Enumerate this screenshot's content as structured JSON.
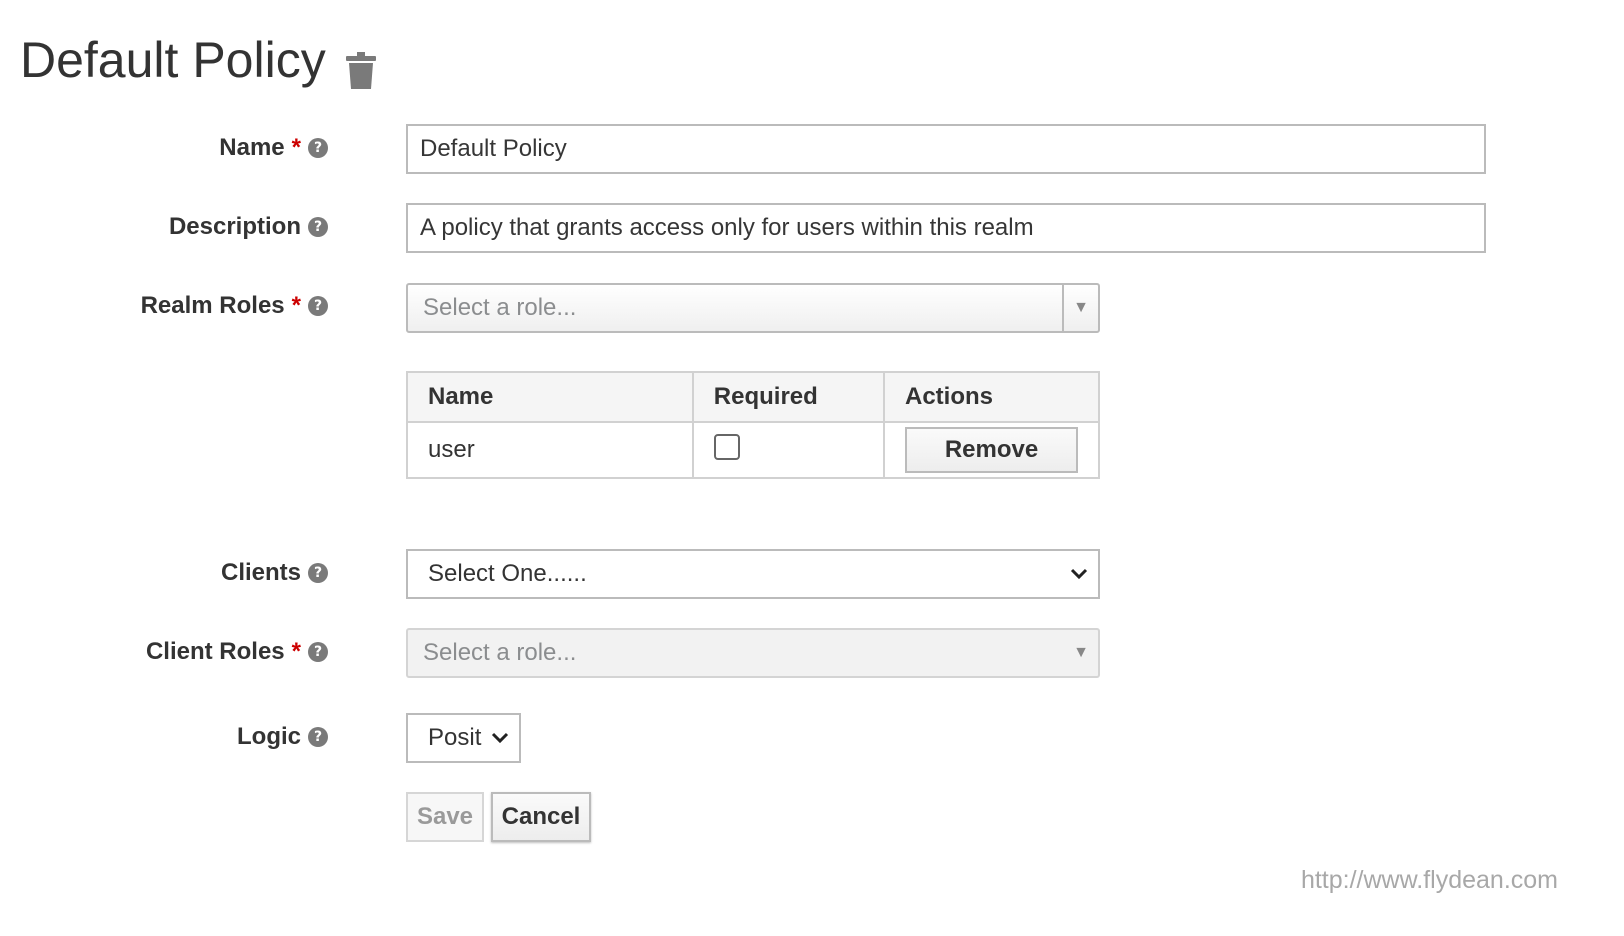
{
  "page": {
    "title": "Default Policy",
    "delete_icon": "trash-icon"
  },
  "form": {
    "name": {
      "label": "Name",
      "required": "*",
      "value": "Default Policy"
    },
    "description": {
      "label": "Description",
      "value": "A policy that grants access only for users within this realm"
    },
    "realm_roles": {
      "label": "Realm Roles",
      "required": "*",
      "placeholder": "Select a role...",
      "table": {
        "columns": [
          "Name",
          "Required",
          "Actions"
        ],
        "rows": [
          {
            "name": "user",
            "required": false,
            "action_label": "Remove"
          }
        ]
      }
    },
    "clients": {
      "label": "Clients",
      "value": "Select One......"
    },
    "client_roles": {
      "label": "Client Roles",
      "required": "*",
      "placeholder": "Select a role..."
    },
    "logic": {
      "label": "Logic",
      "value": "Posit"
    },
    "save_label": "Save",
    "cancel_label": "Cancel"
  },
  "help_glyph": "?",
  "watermark": "http://www.flydean.com",
  "colors": {
    "required": "#cc0000",
    "help_icon": "#7a7a7a",
    "border": "#bbbbbb"
  }
}
